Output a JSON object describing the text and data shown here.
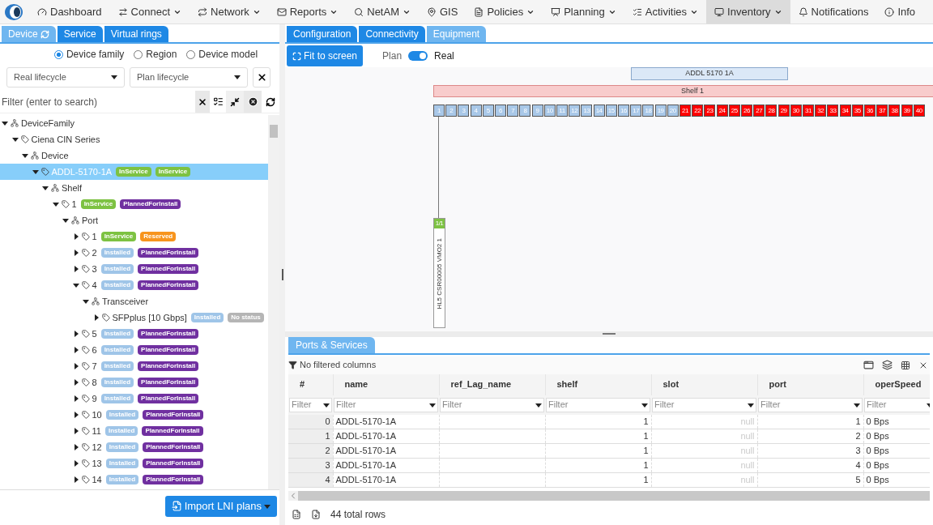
{
  "nav": {
    "items": [
      {
        "label": "Dashboard",
        "dropdown": false,
        "selected": false
      },
      {
        "label": "Connect",
        "dropdown": true,
        "selected": false
      },
      {
        "label": "Network",
        "dropdown": true,
        "selected": false
      },
      {
        "label": "Reports",
        "dropdown": true,
        "selected": false
      },
      {
        "label": "NetAM",
        "dropdown": true,
        "selected": false
      },
      {
        "label": "GIS",
        "dropdown": false,
        "selected": false
      },
      {
        "label": "Policies",
        "dropdown": true,
        "selected": false
      },
      {
        "label": "Planning",
        "dropdown": true,
        "selected": false
      },
      {
        "label": "Activities",
        "dropdown": true,
        "selected": false
      },
      {
        "label": "Inventory",
        "dropdown": true,
        "selected": true
      },
      {
        "label": "Notifications",
        "dropdown": false,
        "selected": false
      },
      {
        "label": "Info",
        "dropdown": false,
        "selected": false
      }
    ]
  },
  "left": {
    "tabs": [
      {
        "label": "Device",
        "selected": true,
        "refresh_icon": true
      },
      {
        "label": "Service",
        "selected": false,
        "refresh_icon": false
      },
      {
        "label": "Virtual rings",
        "selected": false,
        "refresh_icon": false
      }
    ],
    "grouping": [
      {
        "label": "Device family",
        "selected": true
      },
      {
        "label": "Region",
        "selected": false
      },
      {
        "label": "Device model",
        "selected": false
      }
    ],
    "lifecycle_selects": [
      {
        "value": "Real lifecycle"
      },
      {
        "value": "Plan lifecycle"
      }
    ],
    "filter": {
      "placeholder": "Filter (enter to search)"
    },
    "tree": [
      {
        "label": "DeviceFamily",
        "kind": "group",
        "expanded": true,
        "selected": false,
        "children": [
          {
            "label": "Ciena CIN Series",
            "kind": "tag",
            "expanded": true,
            "selected": false,
            "children": [
              {
                "label": "Device",
                "kind": "group",
                "expanded": true,
                "selected": false,
                "children": [
                  {
                    "label": "ADDL-5170-1A",
                    "kind": "tag",
                    "expanded": true,
                    "selected": true,
                    "badges": [
                      {
                        "label": "InService",
                        "color": "#7dc242"
                      },
                      {
                        "label": "InService",
                        "color": "#7dc242"
                      }
                    ],
                    "children": [
                      {
                        "label": "Shelf",
                        "kind": "group",
                        "expanded": true,
                        "selected": false,
                        "children": [
                          {
                            "label": "1",
                            "kind": "tag",
                            "expanded": true,
                            "selected": false,
                            "badges": [
                              {
                                "label": "InService",
                                "color": "#7dc242"
                              },
                              {
                                "label": "PlannedForInstall",
                                "color": "#7030a0"
                              }
                            ],
                            "children": [
                              {
                                "label": "Port",
                                "kind": "group",
                                "expanded": true,
                                "selected": false,
                                "children": [
                                  {
                                    "label": "1",
                                    "kind": "tag",
                                    "expanded": false,
                                    "selected": false,
                                    "badges": [
                                      {
                                        "label": "InService",
                                        "color": "#7dc242"
                                      },
                                      {
                                        "label": "Reserved",
                                        "color": "#f7941d"
                                      }
                                    ]
                                  },
                                  {
                                    "label": "2",
                                    "kind": "tag",
                                    "expanded": false,
                                    "selected": false,
                                    "badges": [
                                      {
                                        "label": "Installed",
                                        "color": "#9fc5e8"
                                      },
                                      {
                                        "label": "PlannedForInstall",
                                        "color": "#7030a0"
                                      }
                                    ]
                                  },
                                  {
                                    "label": "3",
                                    "kind": "tag",
                                    "expanded": false,
                                    "selected": false,
                                    "badges": [
                                      {
                                        "label": "Installed",
                                        "color": "#9fc5e8"
                                      },
                                      {
                                        "label": "PlannedForInstall",
                                        "color": "#7030a0"
                                      }
                                    ]
                                  },
                                  {
                                    "label": "4",
                                    "kind": "tag",
                                    "expanded": true,
                                    "selected": false,
                                    "badges": [
                                      {
                                        "label": "Installed",
                                        "color": "#9fc5e8"
                                      },
                                      {
                                        "label": "PlannedForInstall",
                                        "color": "#7030a0"
                                      }
                                    ],
                                    "children": [
                                      {
                                        "label": "Transceiver",
                                        "kind": "group",
                                        "expanded": true,
                                        "selected": false,
                                        "children": [
                                          {
                                            "label": "SFPplus [10 Gbps]",
                                            "kind": "tag",
                                            "expanded": false,
                                            "selected": false,
                                            "badges": [
                                              {
                                                "label": "Installed",
                                                "color": "#9fc5e8"
                                              },
                                              {
                                                "label": "No status",
                                                "color": "#b5b5b5"
                                              }
                                            ]
                                          }
                                        ]
                                      }
                                    ]
                                  },
                                  {
                                    "label": "5",
                                    "kind": "tag",
                                    "expanded": false,
                                    "selected": false,
                                    "badges": [
                                      {
                                        "label": "Installed",
                                        "color": "#9fc5e8"
                                      },
                                      {
                                        "label": "PlannedForInstall",
                                        "color": "#7030a0"
                                      }
                                    ]
                                  },
                                  {
                                    "label": "6",
                                    "kind": "tag",
                                    "expanded": false,
                                    "selected": false,
                                    "badges": [
                                      {
                                        "label": "Installed",
                                        "color": "#9fc5e8"
                                      },
                                      {
                                        "label": "PlannedForInstall",
                                        "color": "#7030a0"
                                      }
                                    ]
                                  },
                                  {
                                    "label": "7",
                                    "kind": "tag",
                                    "expanded": false,
                                    "selected": false,
                                    "badges": [
                                      {
                                        "label": "Installed",
                                        "color": "#9fc5e8"
                                      },
                                      {
                                        "label": "PlannedForInstall",
                                        "color": "#7030a0"
                                      }
                                    ]
                                  },
                                  {
                                    "label": "8",
                                    "kind": "tag",
                                    "expanded": false,
                                    "selected": false,
                                    "badges": [
                                      {
                                        "label": "Installed",
                                        "color": "#9fc5e8"
                                      },
                                      {
                                        "label": "PlannedForInstall",
                                        "color": "#7030a0"
                                      }
                                    ]
                                  },
                                  {
                                    "label": "9",
                                    "kind": "tag",
                                    "expanded": false,
                                    "selected": false,
                                    "badges": [
                                      {
                                        "label": "Installed",
                                        "color": "#9fc5e8"
                                      },
                                      {
                                        "label": "PlannedForInstall",
                                        "color": "#7030a0"
                                      }
                                    ]
                                  },
                                  {
                                    "label": "10",
                                    "kind": "tag",
                                    "expanded": false,
                                    "selected": false,
                                    "badges": [
                                      {
                                        "label": "Installed",
                                        "color": "#9fc5e8"
                                      },
                                      {
                                        "label": "PlannedForInstall",
                                        "color": "#7030a0"
                                      }
                                    ]
                                  },
                                  {
                                    "label": "11",
                                    "kind": "tag",
                                    "expanded": false,
                                    "selected": false,
                                    "badges": [
                                      {
                                        "label": "Installed",
                                        "color": "#9fc5e8"
                                      },
                                      {
                                        "label": "PlannedForInstall",
                                        "color": "#7030a0"
                                      }
                                    ]
                                  },
                                  {
                                    "label": "12",
                                    "kind": "tag",
                                    "expanded": false,
                                    "selected": false,
                                    "badges": [
                                      {
                                        "label": "Installed",
                                        "color": "#9fc5e8"
                                      },
                                      {
                                        "label": "PlannedForInstall",
                                        "color": "#7030a0"
                                      }
                                    ]
                                  },
                                  {
                                    "label": "13",
                                    "kind": "tag",
                                    "expanded": false,
                                    "selected": false,
                                    "badges": [
                                      {
                                        "label": "Installed",
                                        "color": "#9fc5e8"
                                      },
                                      {
                                        "label": "PlannedForInstall",
                                        "color": "#7030a0"
                                      }
                                    ]
                                  },
                                  {
                                    "label": "14",
                                    "kind": "tag",
                                    "expanded": false,
                                    "selected": false,
                                    "badges": [
                                      {
                                        "label": "Installed",
                                        "color": "#9fc5e8"
                                      },
                                      {
                                        "label": "PlannedForInstall",
                                        "color": "#7030a0"
                                      }
                                    ]
                                  }
                                ]
                              }
                            ]
                          }
                        ]
                      }
                    ]
                  }
                ]
              }
            ]
          }
        ]
      }
    ],
    "import_button": "Import LNI plans"
  },
  "equipment": {
    "tabs": [
      {
        "label": "Configuration",
        "selected": false
      },
      {
        "label": "Connectivity",
        "selected": false
      },
      {
        "label": "Equipment",
        "selected": true
      }
    ],
    "fit_button": "Fit to screen",
    "toggle": {
      "left_label": "Plan",
      "right_label": "Real",
      "on": true
    },
    "device_label": "ADDL 5170 1A",
    "shelf_label": "Shelf 1",
    "ports": [
      {
        "label": "1",
        "color": "#a9c8e8"
      },
      {
        "label": "2",
        "color": "#a9c8e8"
      },
      {
        "label": "3",
        "color": "#a9c8e8"
      },
      {
        "label": "4",
        "color": "#a9c8e8"
      },
      {
        "label": "5",
        "color": "#a9c8e8"
      },
      {
        "label": "6",
        "color": "#a9c8e8"
      },
      {
        "label": "7",
        "color": "#a9c8e8"
      },
      {
        "label": "8",
        "color": "#a9c8e8"
      },
      {
        "label": "9",
        "color": "#a9c8e8"
      },
      {
        "label": "10",
        "color": "#a9c8e8"
      },
      {
        "label": "11",
        "color": "#a9c8e8"
      },
      {
        "label": "12",
        "color": "#a9c8e8"
      },
      {
        "label": "13",
        "color": "#a9c8e8"
      },
      {
        "label": "14",
        "color": "#a9c8e8"
      },
      {
        "label": "15",
        "color": "#a9c8e8"
      },
      {
        "label": "16",
        "color": "#a9c8e8"
      },
      {
        "label": "17",
        "color": "#a9c8e8"
      },
      {
        "label": "18",
        "color": "#a9c8e8"
      },
      {
        "label": "19",
        "color": "#a9c8e8"
      },
      {
        "label": "20",
        "color": "#a9c8e8"
      },
      {
        "label": "21",
        "color": "#ff0000"
      },
      {
        "label": "22",
        "color": "#ff0000"
      },
      {
        "label": "23",
        "color": "#ff0000"
      },
      {
        "label": "24",
        "color": "#ff0000"
      },
      {
        "label": "25",
        "color": "#ff0000"
      },
      {
        "label": "26",
        "color": "#ff0000"
      },
      {
        "label": "27",
        "color": "#ff0000"
      },
      {
        "label": "28",
        "color": "#ff0000"
      },
      {
        "label": "29",
        "color": "#ff0000"
      },
      {
        "label": "30",
        "color": "#ff0000"
      },
      {
        "label": "31",
        "color": "#ff0000"
      },
      {
        "label": "32",
        "color": "#ff0000"
      },
      {
        "label": "33",
        "color": "#ff0000"
      },
      {
        "label": "34",
        "color": "#ff0000"
      },
      {
        "label": "35",
        "color": "#ff0000"
      },
      {
        "label": "36",
        "color": "#ff0000"
      },
      {
        "label": "37",
        "color": "#ff0000"
      },
      {
        "label": "38",
        "color": "#ff0000"
      },
      {
        "label": "39",
        "color": "#ff0000"
      },
      {
        "label": "40",
        "color": "#ff0000"
      }
    ],
    "card": {
      "header": "1/1",
      "label": "HL5 CSR00005 VMO2 1"
    }
  },
  "ports_services": {
    "tab": "Ports & Services",
    "filter_status": "No filtered columns",
    "columns": [
      {
        "label": "#",
        "kind": "index",
        "filter": "Filter"
      },
      {
        "label": "name",
        "kind": "text",
        "filter": "Filter"
      },
      {
        "label": "ref_Lag_name",
        "kind": "text",
        "filter": "Filter"
      },
      {
        "label": "shelf",
        "kind": "number",
        "filter": "Filter"
      },
      {
        "label": "slot",
        "kind": "muted",
        "filter": "Filter"
      },
      {
        "label": "port",
        "kind": "number",
        "filter": "Filter"
      },
      {
        "label": "operSpeed",
        "kind": "text",
        "filter": "Filter"
      }
    ],
    "rows": [
      [
        "0",
        "ADDL-5170-1A",
        null,
        "1",
        "null",
        "1",
        "0 Bps"
      ],
      [
        "1",
        "ADDL-5170-1A",
        null,
        "1",
        "null",
        "2",
        "0 Bps"
      ],
      [
        "2",
        "ADDL-5170-1A",
        null,
        "1",
        "null",
        "3",
        "0 Bps"
      ],
      [
        "3",
        "ADDL-5170-1A",
        null,
        "1",
        "null",
        "4",
        "0 Bps"
      ],
      [
        "4",
        "ADDL-5170-1A",
        null,
        "1",
        "null",
        "5",
        "0 Bps"
      ]
    ],
    "total_rows": "44 total rows"
  }
}
